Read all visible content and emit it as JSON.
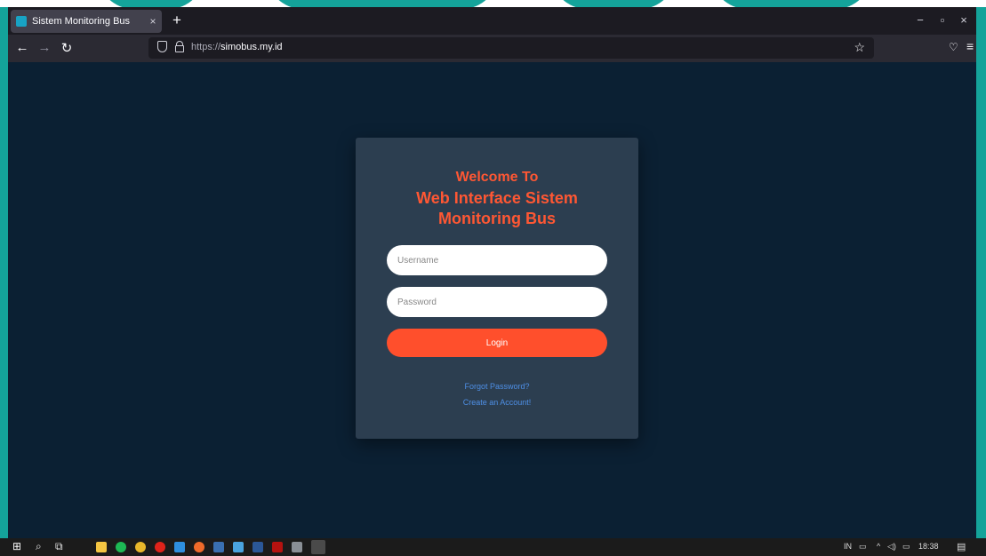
{
  "browser": {
    "tab_title": "Sistem Monitoring Bus",
    "tab_close": "×",
    "new_tab": "+",
    "url_protocol": "https://",
    "url_host": "simobus.my.id",
    "win_minimize": "−",
    "win_restore": "▫",
    "win_close": "×"
  },
  "login": {
    "welcome": "Welcome To",
    "heading_line1": "Web Interface Sistem",
    "heading_line2": "Monitoring Bus",
    "username_placeholder": "Username",
    "password_placeholder": "Password",
    "login_label": "Login",
    "forgot_password": "Forgot Password?",
    "create_account": "Create an Account!"
  },
  "taskbar": {
    "language": "IN",
    "time": "18:38"
  },
  "colors": {
    "page_bg": "#0b2033",
    "card_bg": "#2c3e50",
    "accent": "#ff5733",
    "link": "#4e8fe6"
  }
}
